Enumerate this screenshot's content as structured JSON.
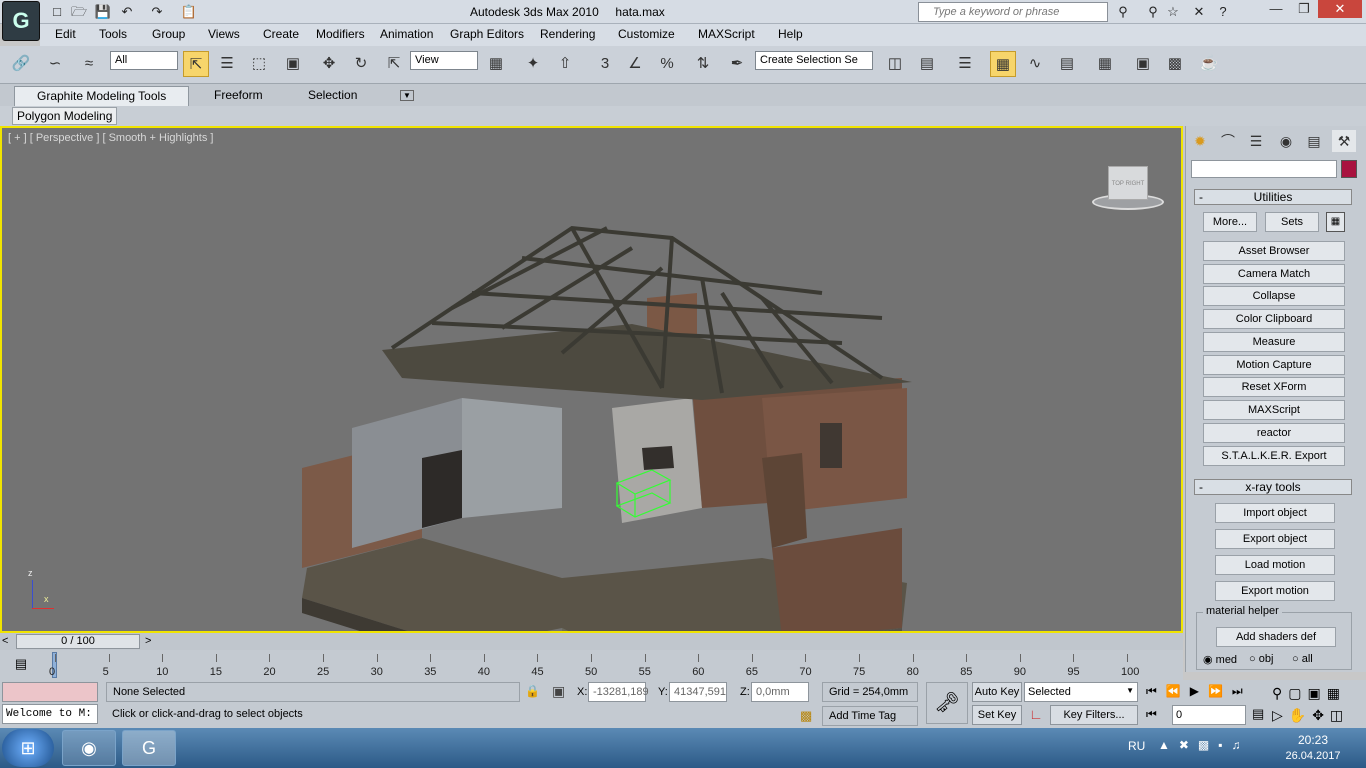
{
  "title": {
    "app": "Autodesk 3ds Max  2010",
    "file": "hata.max"
  },
  "search": {
    "placeholder": "Type a keyword or phrase"
  },
  "menu": [
    "Edit",
    "Tools",
    "Group",
    "Views",
    "Create",
    "Modifiers",
    "Animation",
    "Graph Editors",
    "Rendering",
    "Customize",
    "MAXScript",
    "Help"
  ],
  "toolbar": {
    "filter": "All",
    "refcoord": "View",
    "selection_set": "Create Selection Se"
  },
  "ribbon": {
    "tabs": [
      "Graphite Modeling Tools",
      "Freeform",
      "Selection"
    ],
    "panel": "Polygon Modeling"
  },
  "viewport": {
    "label": "[ + ] [ Perspective ] [ Smooth + Highlights ]",
    "cube_left": "TOP",
    "cube_right": "RIGHT",
    "axis_z": "z",
    "axis_x": "x"
  },
  "utilities": {
    "header": "Utilities",
    "more": "More...",
    "sets": "Sets",
    "items": [
      "Asset Browser",
      "Camera Match",
      "Collapse",
      "Color Clipboard",
      "Measure",
      "Motion Capture",
      "Reset XForm",
      "MAXScript",
      "reactor",
      "S.T.A.L.K.E.R. Export"
    ]
  },
  "xray": {
    "header": "x-ray tools",
    "items": [
      "Import object",
      "Export object",
      "Load motion",
      "Export motion"
    ],
    "group": "material helper",
    "add_shaders": "Add shaders def",
    "radios": [
      "med",
      "obj",
      "all"
    ]
  },
  "timeline": {
    "frame": "0 / 100",
    "ticks": [
      "0",
      "5",
      "10",
      "15",
      "20",
      "25",
      "30",
      "35",
      "40",
      "45",
      "50",
      "55",
      "60",
      "65",
      "70",
      "75",
      "80",
      "85",
      "90",
      "95",
      "100"
    ]
  },
  "status": {
    "listener": "Welcome to M:",
    "selection": "None Selected",
    "prompt": "Click or click-and-drag to select objects",
    "x_label": "X:",
    "x": "-13281,189",
    "y_label": "Y:",
    "y": "41347,591",
    "z_label": "Z:",
    "z": "0,0mm",
    "grid": "Grid = 254,0mm",
    "add_time_tag": "Add Time Tag",
    "auto_key": "Auto Key",
    "set_key": "Set Key",
    "key_mode": "Selected",
    "key_filters": "Key Filters...",
    "current_frame": "0"
  },
  "taskbar": {
    "lang": "RU",
    "time": "20:23",
    "date": "26.04.2017"
  }
}
